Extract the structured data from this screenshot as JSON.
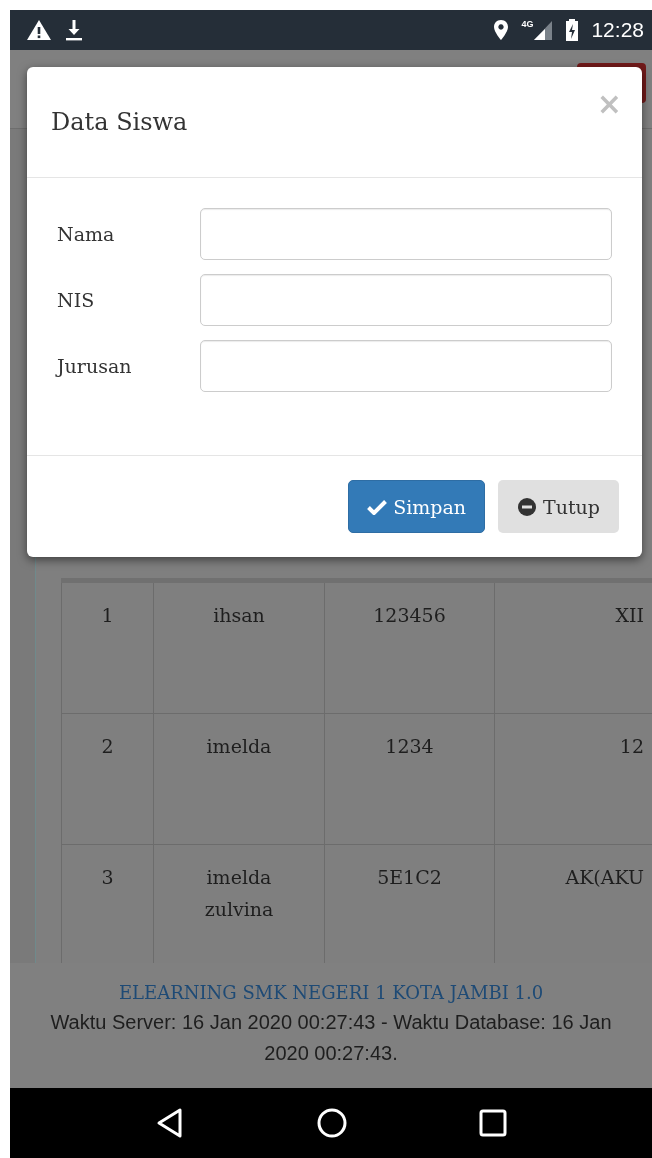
{
  "status_bar": {
    "network": "4G",
    "time": "12:28"
  },
  "modal": {
    "title": "Data Siswa",
    "close": "×",
    "fields": [
      {
        "label": "Nama"
      },
      {
        "label": "NIS"
      },
      {
        "label": "Jurusan"
      }
    ],
    "buttons": [
      {
        "label": "Simpan",
        "kind": "primary"
      },
      {
        "label": "Tutup",
        "kind": "default"
      }
    ]
  },
  "table": {
    "rows": [
      {
        "no": "1",
        "name": "ihsan",
        "nis": "123456",
        "column_4": "XII"
      },
      {
        "no": "2",
        "name": "imelda",
        "nis": "1234",
        "column_4": "12"
      },
      {
        "no": "3",
        "name": "imelda zulvina",
        "nis": "5E1C2",
        "column_4": "AK(AKU"
      }
    ]
  },
  "footer": {
    "title": "ELEARNING SMK NEGERI 1 KOTA JAMBI 1.0",
    "text": "Waktu Server: 16 Jan 2020 00:27:43 - Waktu Database: 16 Jan 2020 00:27:43."
  }
}
